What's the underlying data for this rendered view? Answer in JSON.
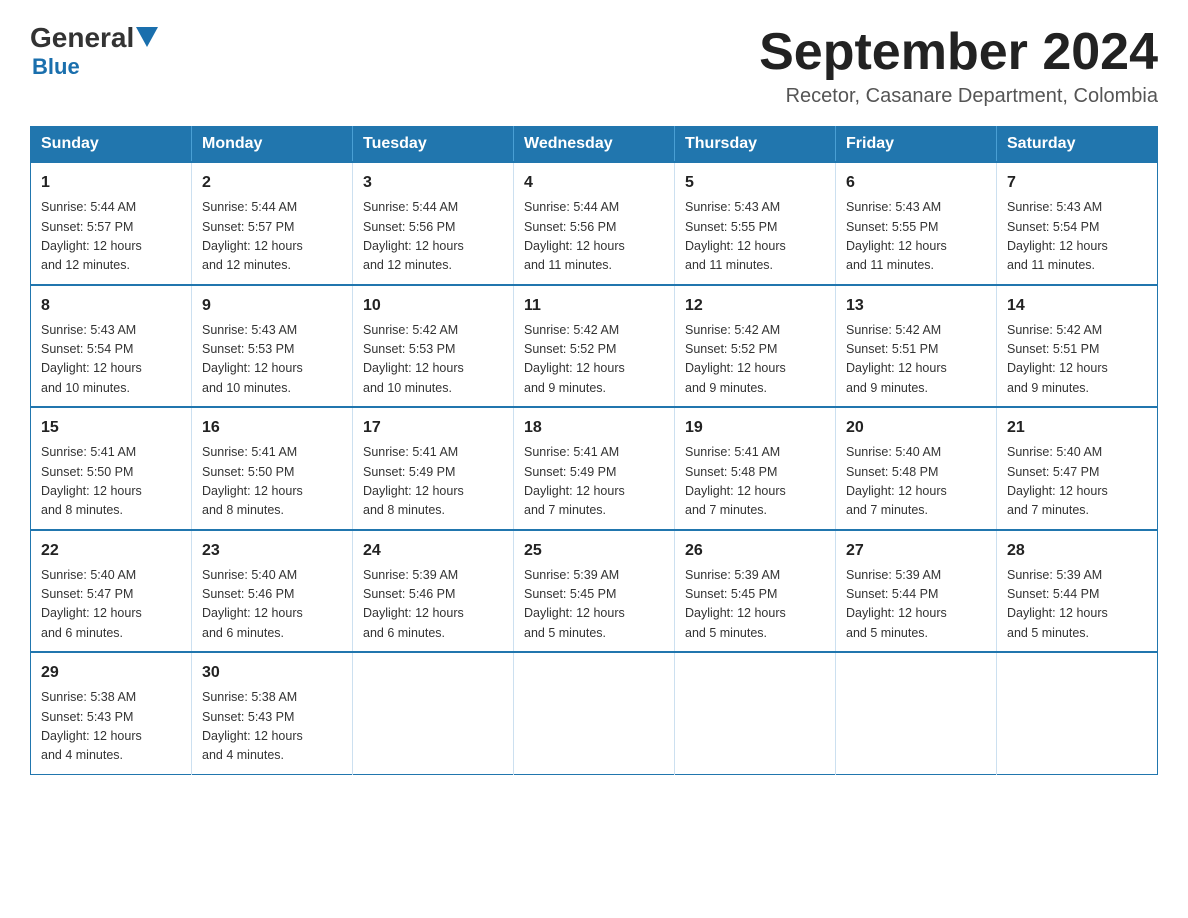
{
  "logo": {
    "general": "General",
    "blue": "Blue",
    "underline": "Blue"
  },
  "header": {
    "month_title": "September 2024",
    "subtitle": "Recetor, Casanare Department, Colombia"
  },
  "weekdays": [
    "Sunday",
    "Monday",
    "Tuesday",
    "Wednesday",
    "Thursday",
    "Friday",
    "Saturday"
  ],
  "weeks": [
    [
      {
        "day": "1",
        "info": "Sunrise: 5:44 AM\nSunset: 5:57 PM\nDaylight: 12 hours\nand 12 minutes."
      },
      {
        "day": "2",
        "info": "Sunrise: 5:44 AM\nSunset: 5:57 PM\nDaylight: 12 hours\nand 12 minutes."
      },
      {
        "day": "3",
        "info": "Sunrise: 5:44 AM\nSunset: 5:56 PM\nDaylight: 12 hours\nand 12 minutes."
      },
      {
        "day": "4",
        "info": "Sunrise: 5:44 AM\nSunset: 5:56 PM\nDaylight: 12 hours\nand 11 minutes."
      },
      {
        "day": "5",
        "info": "Sunrise: 5:43 AM\nSunset: 5:55 PM\nDaylight: 12 hours\nand 11 minutes."
      },
      {
        "day": "6",
        "info": "Sunrise: 5:43 AM\nSunset: 5:55 PM\nDaylight: 12 hours\nand 11 minutes."
      },
      {
        "day": "7",
        "info": "Sunrise: 5:43 AM\nSunset: 5:54 PM\nDaylight: 12 hours\nand 11 minutes."
      }
    ],
    [
      {
        "day": "8",
        "info": "Sunrise: 5:43 AM\nSunset: 5:54 PM\nDaylight: 12 hours\nand 10 minutes."
      },
      {
        "day": "9",
        "info": "Sunrise: 5:43 AM\nSunset: 5:53 PM\nDaylight: 12 hours\nand 10 minutes."
      },
      {
        "day": "10",
        "info": "Sunrise: 5:42 AM\nSunset: 5:53 PM\nDaylight: 12 hours\nand 10 minutes."
      },
      {
        "day": "11",
        "info": "Sunrise: 5:42 AM\nSunset: 5:52 PM\nDaylight: 12 hours\nand 9 minutes."
      },
      {
        "day": "12",
        "info": "Sunrise: 5:42 AM\nSunset: 5:52 PM\nDaylight: 12 hours\nand 9 minutes."
      },
      {
        "day": "13",
        "info": "Sunrise: 5:42 AM\nSunset: 5:51 PM\nDaylight: 12 hours\nand 9 minutes."
      },
      {
        "day": "14",
        "info": "Sunrise: 5:42 AM\nSunset: 5:51 PM\nDaylight: 12 hours\nand 9 minutes."
      }
    ],
    [
      {
        "day": "15",
        "info": "Sunrise: 5:41 AM\nSunset: 5:50 PM\nDaylight: 12 hours\nand 8 minutes."
      },
      {
        "day": "16",
        "info": "Sunrise: 5:41 AM\nSunset: 5:50 PM\nDaylight: 12 hours\nand 8 minutes."
      },
      {
        "day": "17",
        "info": "Sunrise: 5:41 AM\nSunset: 5:49 PM\nDaylight: 12 hours\nand 8 minutes."
      },
      {
        "day": "18",
        "info": "Sunrise: 5:41 AM\nSunset: 5:49 PM\nDaylight: 12 hours\nand 7 minutes."
      },
      {
        "day": "19",
        "info": "Sunrise: 5:41 AM\nSunset: 5:48 PM\nDaylight: 12 hours\nand 7 minutes."
      },
      {
        "day": "20",
        "info": "Sunrise: 5:40 AM\nSunset: 5:48 PM\nDaylight: 12 hours\nand 7 minutes."
      },
      {
        "day": "21",
        "info": "Sunrise: 5:40 AM\nSunset: 5:47 PM\nDaylight: 12 hours\nand 7 minutes."
      }
    ],
    [
      {
        "day": "22",
        "info": "Sunrise: 5:40 AM\nSunset: 5:47 PM\nDaylight: 12 hours\nand 6 minutes."
      },
      {
        "day": "23",
        "info": "Sunrise: 5:40 AM\nSunset: 5:46 PM\nDaylight: 12 hours\nand 6 minutes."
      },
      {
        "day": "24",
        "info": "Sunrise: 5:39 AM\nSunset: 5:46 PM\nDaylight: 12 hours\nand 6 minutes."
      },
      {
        "day": "25",
        "info": "Sunrise: 5:39 AM\nSunset: 5:45 PM\nDaylight: 12 hours\nand 5 minutes."
      },
      {
        "day": "26",
        "info": "Sunrise: 5:39 AM\nSunset: 5:45 PM\nDaylight: 12 hours\nand 5 minutes."
      },
      {
        "day": "27",
        "info": "Sunrise: 5:39 AM\nSunset: 5:44 PM\nDaylight: 12 hours\nand 5 minutes."
      },
      {
        "day": "28",
        "info": "Sunrise: 5:39 AM\nSunset: 5:44 PM\nDaylight: 12 hours\nand 5 minutes."
      }
    ],
    [
      {
        "day": "29",
        "info": "Sunrise: 5:38 AM\nSunset: 5:43 PM\nDaylight: 12 hours\nand 4 minutes."
      },
      {
        "day": "30",
        "info": "Sunrise: 5:38 AM\nSunset: 5:43 PM\nDaylight: 12 hours\nand 4 minutes."
      },
      {
        "day": "",
        "info": ""
      },
      {
        "day": "",
        "info": ""
      },
      {
        "day": "",
        "info": ""
      },
      {
        "day": "",
        "info": ""
      },
      {
        "day": "",
        "info": ""
      }
    ]
  ]
}
